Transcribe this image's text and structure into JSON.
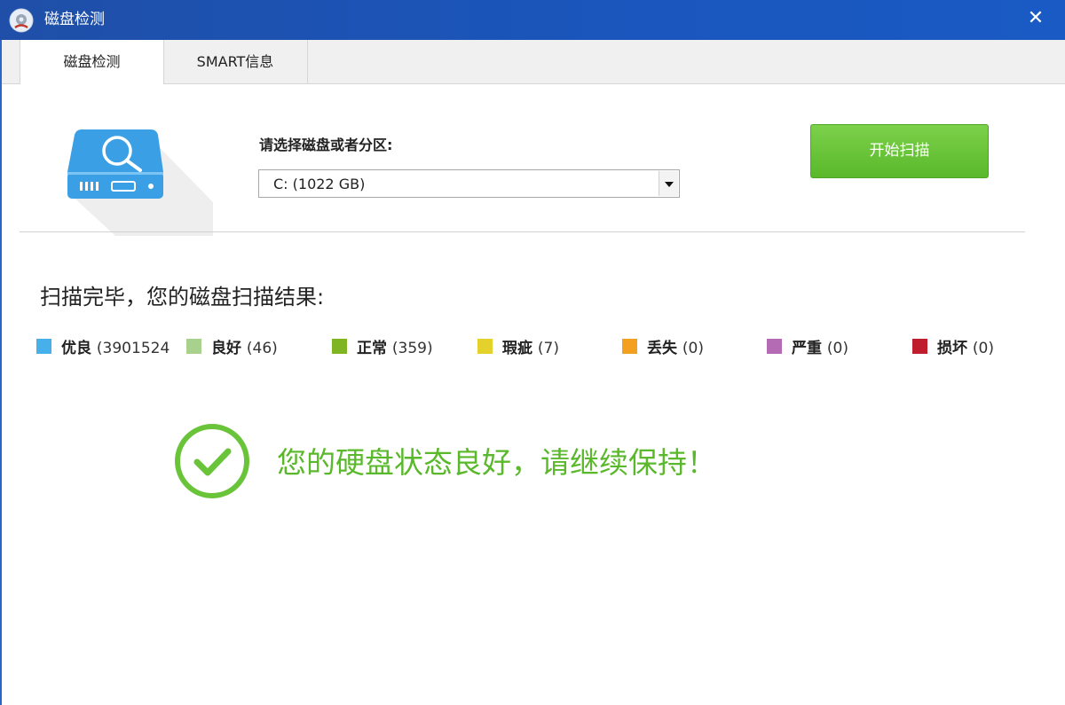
{
  "window": {
    "title": "磁盘检测",
    "close_glyph": "✕",
    "app_icon": "disk-scan-app-icon",
    "close_icon": "close-icon"
  },
  "tabs": [
    {
      "label": "磁盘检测",
      "active": true
    },
    {
      "label": "SMART信息",
      "active": false
    }
  ],
  "disk_select": {
    "label": "请选择磁盘或者分区:",
    "value": "C:  (1022 GB)",
    "icon": "dropdown-arrow-icon"
  },
  "scan_button": {
    "label": "开始扫描"
  },
  "result": {
    "heading": "扫描完毕，您的磁盘扫描结果:",
    "legend": [
      {
        "label": "优良",
        "count": "(3901524",
        "color": "#45b0ea"
      },
      {
        "label": "良好",
        "count": "(46)",
        "color": "#a8d18d"
      },
      {
        "label": "正常",
        "count": "(359)",
        "color": "#7fb523"
      },
      {
        "label": "瑕疵",
        "count": "(7)",
        "color": "#e4d12c"
      },
      {
        "label": "丢失",
        "count": "(0)",
        "color": "#f39f1f"
      },
      {
        "label": "严重",
        "count": "(0)",
        "color": "#b46bb3"
      },
      {
        "label": "损坏",
        "count": "(0)",
        "color": "#bf1e2d"
      }
    ],
    "status_text": "您的硬盘状态良好，请继续保持！",
    "status_color": "#5ab82b",
    "status_icon": "check-circle-icon"
  },
  "colors": {
    "titlebar": "#1f4fa8",
    "accent_green": "#6ac43a",
    "disk_blue": "#3b9fe6"
  }
}
